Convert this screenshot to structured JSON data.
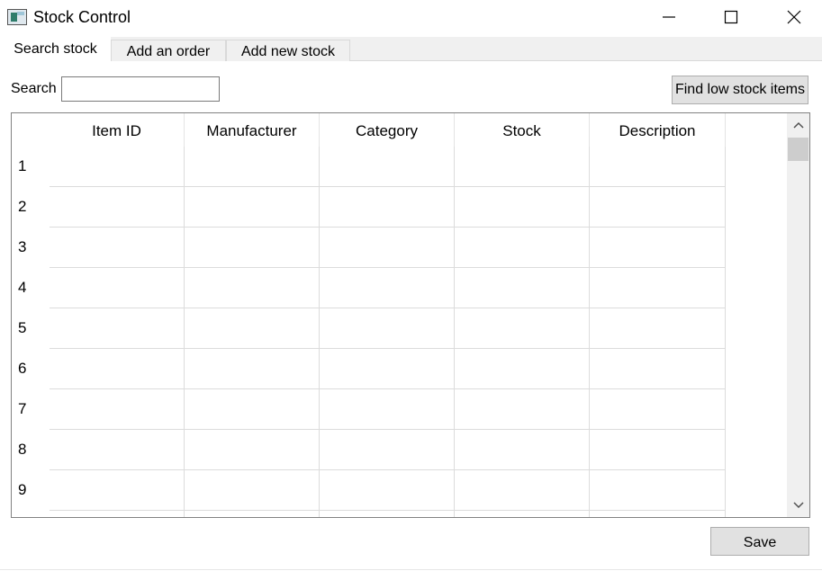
{
  "window": {
    "title": "Stock Control",
    "icon": "app-window-icon",
    "controls": [
      "minimize-icon",
      "maximize-icon",
      "close-icon"
    ]
  },
  "tabs": [
    {
      "label": "Search stock",
      "active": true
    },
    {
      "label": "Add an order",
      "active": false
    },
    {
      "label": "Add new stock",
      "active": false
    }
  ],
  "search": {
    "label": "Search",
    "value": "",
    "placeholder": ""
  },
  "buttons": {
    "find_low_stock": "Find low stock items",
    "save": "Save"
  },
  "table": {
    "columns": [
      "Item ID",
      "Manufacturer",
      "Category",
      "Stock",
      "Description"
    ],
    "row_numbers": [
      "1",
      "2",
      "3",
      "4",
      "5",
      "6",
      "7",
      "8",
      "9"
    ],
    "rows": [
      [
        "",
        "",
        "",
        "",
        ""
      ],
      [
        "",
        "",
        "",
        "",
        ""
      ],
      [
        "",
        "",
        "",
        "",
        ""
      ],
      [
        "",
        "",
        "",
        "",
        ""
      ],
      [
        "",
        "",
        "",
        "",
        ""
      ],
      [
        "",
        "",
        "",
        "",
        ""
      ],
      [
        "",
        "",
        "",
        "",
        ""
      ],
      [
        "",
        "",
        "",
        "",
        ""
      ],
      [
        "",
        "",
        "",
        "",
        ""
      ]
    ]
  },
  "scrollbar": {
    "up_icon": "chevron-up-icon",
    "down_icon": "chevron-down-icon"
  }
}
